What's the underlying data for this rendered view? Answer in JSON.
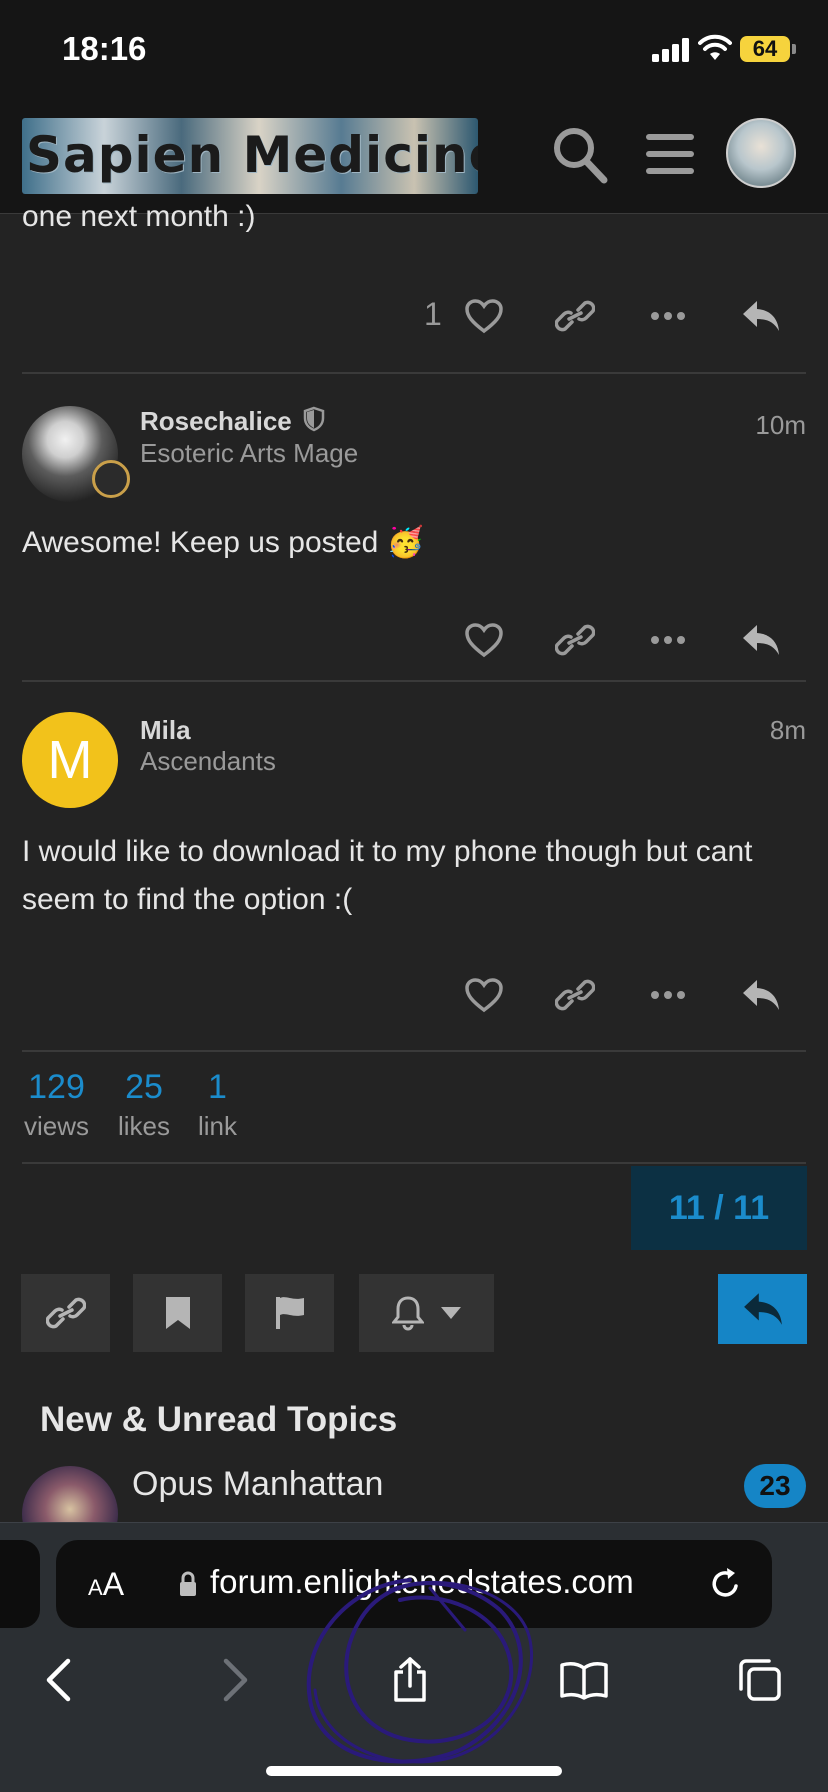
{
  "status": {
    "time": "18:16",
    "battery": "64"
  },
  "header": {
    "logo_text": "Sapien Medicine",
    "search_icon": "search-icon",
    "menu_icon": "hamburger-menu-icon"
  },
  "prev_post": {
    "cut_text": "one next month :)",
    "like_count": "1"
  },
  "posts": [
    {
      "username": "Rosechalice",
      "user_title": "Esoteric Arts Mage",
      "time": "10m",
      "body": "Awesome! Keep us posted 🥳"
    },
    {
      "username": "Mila",
      "avatar_letter": "M",
      "user_title": "Ascendants",
      "time": "8m",
      "body": "I would like to download it to my phone though but cant seem to find the option :("
    }
  ],
  "stats": [
    {
      "num": "129",
      "label": "views"
    },
    {
      "num": "25",
      "label": "likes"
    },
    {
      "num": "1",
      "label": "link"
    }
  ],
  "progress": "11 / 11",
  "section_title": "New & Unread Topics",
  "topic": {
    "title": "Opus Manhattan",
    "count": "23"
  },
  "browser": {
    "aa_small": "A",
    "aa_big": "A",
    "url": "forum.enlightenedstates.com"
  },
  "colors": {
    "accent": "#1585c6",
    "link_blue": "#1b8ccc",
    "background": "#232323",
    "header": "#151515"
  }
}
